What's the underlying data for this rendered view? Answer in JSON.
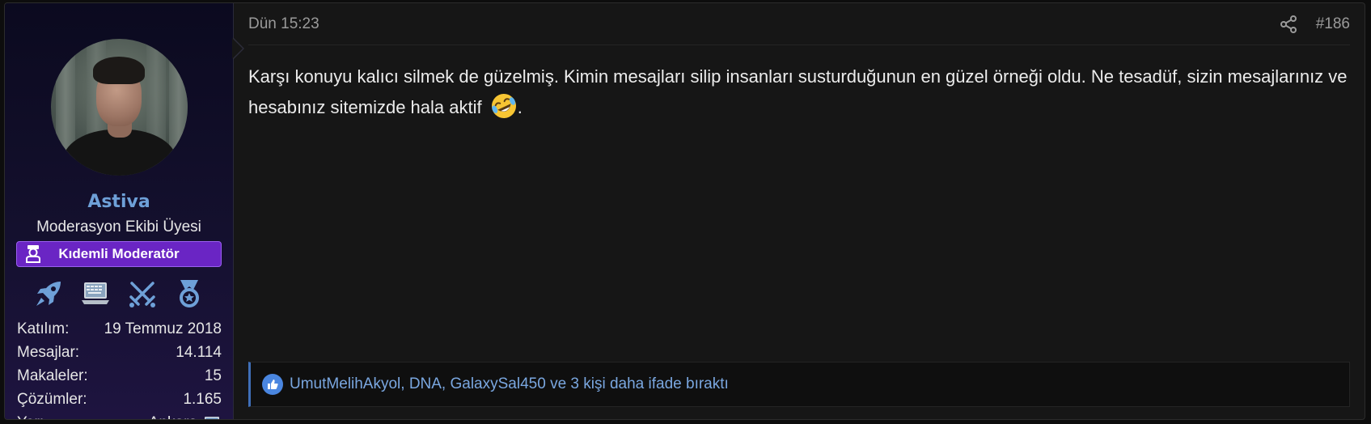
{
  "user": {
    "name": "Astiva",
    "title": "Moderasyon Ekibi Üyesi",
    "banner": "Kıdemli Moderatör",
    "trophies": [
      "rocket-icon",
      "laptop-icon",
      "crossed-swords-icon",
      "medal-icon"
    ],
    "stats": [
      {
        "label": "Katılım:",
        "value": "19 Temmuz 2018"
      },
      {
        "label": "Mesajlar:",
        "value": "14.114"
      },
      {
        "label": "Makaleler:",
        "value": "15"
      },
      {
        "label": "Çözümler:",
        "value": "1.165"
      },
      {
        "label": "Yer:",
        "value": "Ankara"
      }
    ],
    "location_icon": "laptop-icon"
  },
  "post": {
    "date": "Dün 15:23",
    "number": "#186",
    "body": "Karşı konuyu kalıcı silmek de güzelmiş. Kimin mesajları silip insanları susturduğunun en güzel örneği oldu. Ne tesadüf, sizin mesajlarınız ve hesabınız sitemizde hala aktif",
    "body_end": ".",
    "emoji": "rolling-on-floor-laughing-emoji",
    "reactions": "UmutMelihAkyol, DNA, GalaxySal450 ve 3 kişi daha ifade bıraktı"
  },
  "colors": {
    "accent": "#6ea0d8",
    "banner": "#6a25c4",
    "reaction_link": "#7aa7e0"
  }
}
